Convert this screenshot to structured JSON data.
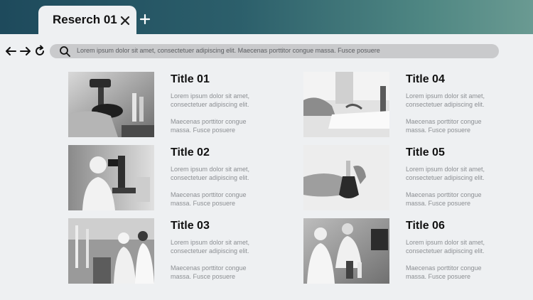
{
  "tab": {
    "title": "Reserch 01"
  },
  "search": {
    "text": "Lorem ipsum dolor sit amet, consectetuer adipiscing elit. Maecenas porttitor congue massa. Fusce posuere"
  },
  "cards": [
    {
      "title": "Title 01",
      "body_line1": "Lorem ipsum dolor sit amet,",
      "body_line2": "consectetuer adipiscing elit.",
      "body_line3": "Maecenas porttitor congue",
      "body_line4": "massa. Fusce posuere"
    },
    {
      "title": "Title 02",
      "body_line1": "Lorem ipsum dolor sit amet,",
      "body_line2": "consectetuer adipiscing elit.",
      "body_line3": "Maecenas porttitor congue",
      "body_line4": "massa. Fusce posuere"
    },
    {
      "title": "Title 03",
      "body_line1": "Lorem ipsum dolor sit amet,",
      "body_line2": "consectetuer adipiscing elit.",
      "body_line3": "Maecenas porttitor congue",
      "body_line4": "massa. Fusce posuere"
    },
    {
      "title": "Title 04",
      "body_line1": "Lorem ipsum dolor sit amet,",
      "body_line2": "consectetuer adipiscing elit.",
      "body_line3": "Maecenas porttitor congue",
      "body_line4": "massa. Fusce posuere"
    },
    {
      "title": "Title 05",
      "body_line1": "Lorem ipsum dolor sit amet,",
      "body_line2": "consectetuer adipiscing elit.",
      "body_line3": "Maecenas porttitor congue",
      "body_line4": "massa. Fusce posuere"
    },
    {
      "title": "Title 06",
      "body_line1": "Lorem ipsum dolor sit amet,",
      "body_line2": "consectetuer adipiscing elit.",
      "body_line3": "Maecenas porttitor congue",
      "body_line4": "massa. Fusce posuere"
    }
  ],
  "icons": {
    "close": "close-icon",
    "new_tab": "plus-icon",
    "back": "arrow-left-icon",
    "forward": "arrow-right-icon",
    "reload": "reload-icon",
    "search": "search-icon"
  },
  "colors": {
    "titlebar_start": "#1e4a5c",
    "titlebar_end": "#6a9a92",
    "background": "#eef0f2",
    "searchbar": "#c9cacc"
  }
}
